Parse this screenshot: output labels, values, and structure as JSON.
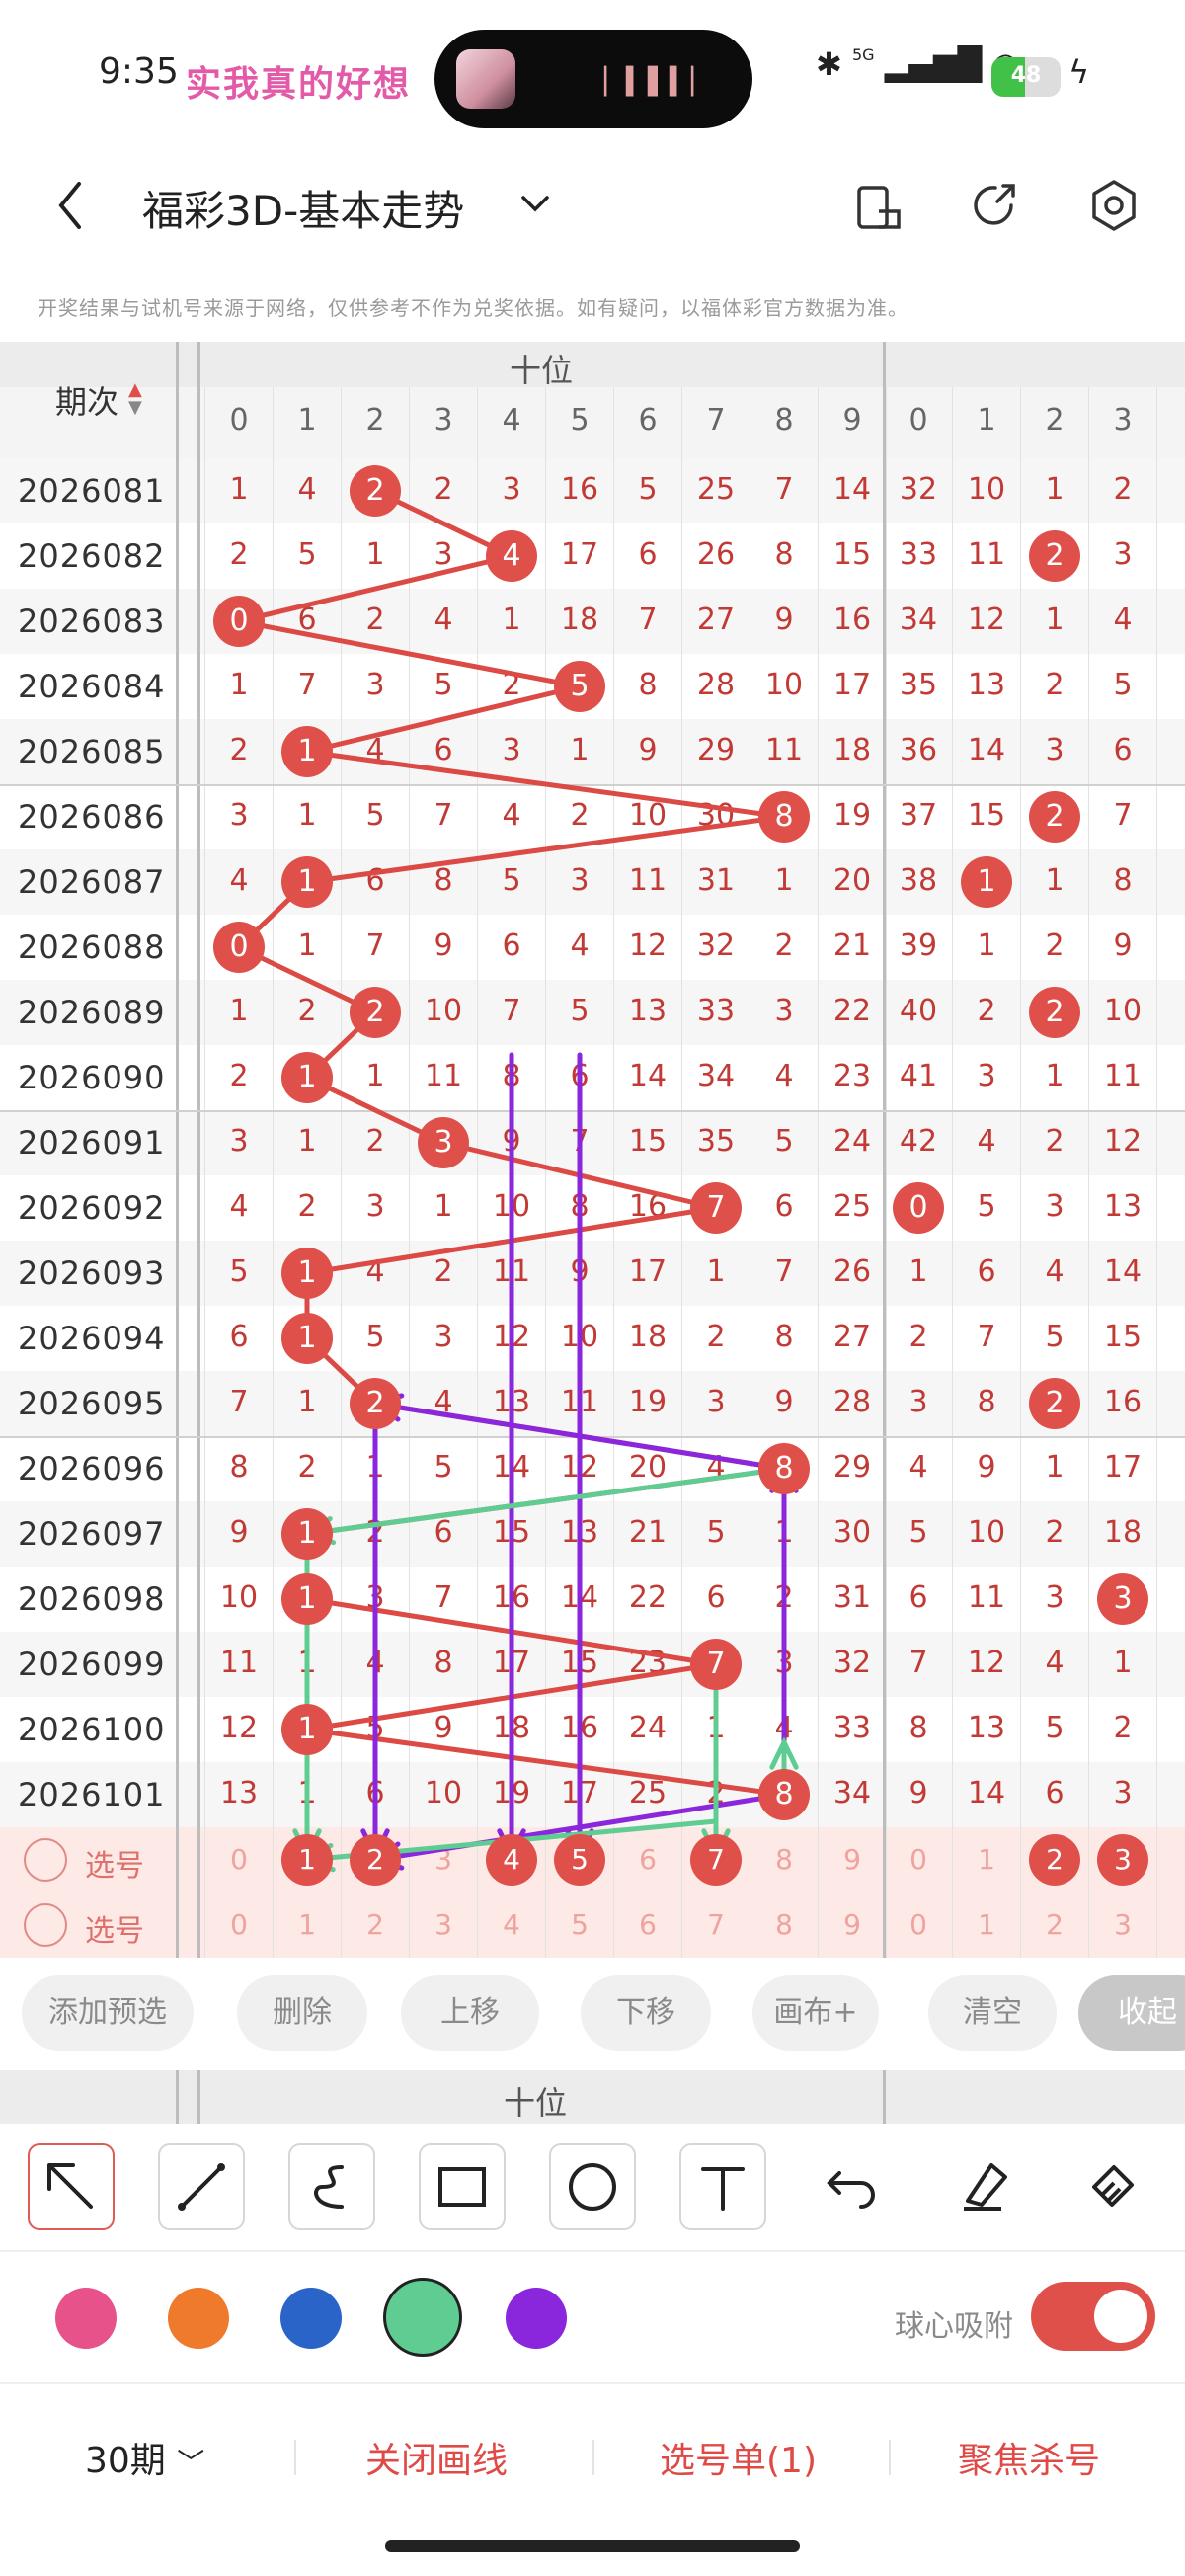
{
  "status": {
    "time": "9:35",
    "marquee": "实我真的好想",
    "battery": "48",
    "signal_label": "5G"
  },
  "header": {
    "title": "福彩3D-基本走势"
  },
  "disclaimer": "开奖结果与试机号来源于网络，仅供参考不作为兑奖依据。如有疑问，以福体彩官方数据为准。",
  "grid": {
    "period_label": "期次",
    "section_label": "十位",
    "columns": [
      "0",
      "1",
      "2",
      "3",
      "4",
      "5",
      "6",
      "7",
      "8",
      "9"
    ],
    "columns_next": [
      "0",
      "1",
      "2",
      "3"
    ],
    "select_label": "选号",
    "rows": [
      {
        "period": "2026081",
        "cells": [
          "1",
          "4",
          "2",
          "2",
          "3",
          "16",
          "5",
          "25",
          "7",
          "14"
        ],
        "next": [
          "32",
          "10",
          "1",
          "2"
        ],
        "hit": 2
      },
      {
        "period": "2026082",
        "cells": [
          "2",
          "5",
          "1",
          "3",
          "4",
          "17",
          "6",
          "26",
          "8",
          "15"
        ],
        "next": [
          "33",
          "11",
          "2",
          "3"
        ],
        "hit": 4
      },
      {
        "period": "2026083",
        "cells": [
          "0",
          "6",
          "2",
          "4",
          "1",
          "18",
          "7",
          "27",
          "9",
          "16"
        ],
        "next": [
          "34",
          "12",
          "1",
          "4"
        ],
        "hit": 0
      },
      {
        "period": "2026084",
        "cells": [
          "1",
          "7",
          "3",
          "5",
          "2",
          "5",
          "8",
          "28",
          "10",
          "17"
        ],
        "next": [
          "35",
          "13",
          "2",
          "5"
        ],
        "hit": 5
      },
      {
        "period": "2026085",
        "cells": [
          "2",
          "1",
          "4",
          "6",
          "3",
          "1",
          "9",
          "29",
          "11",
          "18"
        ],
        "next": [
          "36",
          "14",
          "3",
          "6"
        ],
        "hit": 1
      },
      {
        "period": "2026086",
        "cells": [
          "3",
          "1",
          "5",
          "7",
          "4",
          "2",
          "10",
          "30",
          "8",
          "19"
        ],
        "next": [
          "37",
          "15",
          "2",
          "7"
        ],
        "hit": 8
      },
      {
        "period": "2026087",
        "cells": [
          "4",
          "1",
          "6",
          "8",
          "5",
          "3",
          "11",
          "31",
          "1",
          "20"
        ],
        "next": [
          "38",
          "1",
          "1",
          "8"
        ],
        "hit": 1
      },
      {
        "period": "2026088",
        "cells": [
          "0",
          "1",
          "7",
          "9",
          "6",
          "4",
          "12",
          "32",
          "2",
          "21"
        ],
        "next": [
          "39",
          "1",
          "2",
          "9"
        ],
        "hit": 0
      },
      {
        "period": "2026089",
        "cells": [
          "1",
          "2",
          "2",
          "10",
          "7",
          "5",
          "13",
          "33",
          "3",
          "22"
        ],
        "next": [
          "40",
          "2",
          "2",
          "10"
        ],
        "hit": 2
      },
      {
        "period": "2026090",
        "cells": [
          "2",
          "1",
          "1",
          "11",
          "8",
          "6",
          "14",
          "34",
          "4",
          "23"
        ],
        "next": [
          "41",
          "3",
          "1",
          "11"
        ],
        "hit": 1
      },
      {
        "period": "2026091",
        "cells": [
          "3",
          "1",
          "2",
          "3",
          "9",
          "7",
          "15",
          "35",
          "5",
          "24"
        ],
        "next": [
          "42",
          "4",
          "2",
          "12"
        ],
        "hit": 3
      },
      {
        "period": "2026092",
        "cells": [
          "4",
          "2",
          "3",
          "1",
          "10",
          "8",
          "16",
          "7",
          "6",
          "25"
        ],
        "next": [
          "0",
          "5",
          "3",
          "13"
        ],
        "hit": 7
      },
      {
        "period": "2026093",
        "cells": [
          "5",
          "1",
          "4",
          "2",
          "11",
          "9",
          "17",
          "1",
          "7",
          "26"
        ],
        "next": [
          "1",
          "6",
          "4",
          "14"
        ],
        "hit": 1
      },
      {
        "period": "2026094",
        "cells": [
          "6",
          "1",
          "5",
          "3",
          "12",
          "10",
          "18",
          "2",
          "8",
          "27"
        ],
        "next": [
          "2",
          "7",
          "5",
          "15"
        ],
        "hit": 1
      },
      {
        "period": "2026095",
        "cells": [
          "7",
          "1",
          "2",
          "4",
          "13",
          "11",
          "19",
          "3",
          "9",
          "28"
        ],
        "next": [
          "3",
          "8",
          "2",
          "16"
        ],
        "hit": 2
      },
      {
        "period": "2026096",
        "cells": [
          "8",
          "2",
          "1",
          "5",
          "14",
          "12",
          "20",
          "4",
          "8",
          "29"
        ],
        "next": [
          "4",
          "9",
          "1",
          "17"
        ],
        "hit": 8
      },
      {
        "period": "2026097",
        "cells": [
          "9",
          "1",
          "2",
          "6",
          "15",
          "13",
          "21",
          "5",
          "1",
          "30"
        ],
        "next": [
          "5",
          "10",
          "2",
          "18"
        ],
        "hit": 1
      },
      {
        "period": "2026098",
        "cells": [
          "10",
          "1",
          "3",
          "7",
          "16",
          "14",
          "22",
          "6",
          "2",
          "31"
        ],
        "next": [
          "6",
          "11",
          "3",
          "3"
        ],
        "hit": 1
      },
      {
        "period": "2026099",
        "cells": [
          "11",
          "1",
          "4",
          "8",
          "17",
          "15",
          "23",
          "7",
          "3",
          "32"
        ],
        "next": [
          "7",
          "12",
          "4",
          "1"
        ],
        "hit": 7
      },
      {
        "period": "2026100",
        "cells": [
          "12",
          "1",
          "5",
          "9",
          "18",
          "16",
          "24",
          "1",
          "4",
          "33"
        ],
        "next": [
          "8",
          "13",
          "5",
          "2"
        ],
        "hit": 1
      },
      {
        "period": "2026101",
        "cells": [
          "13",
          "1",
          "6",
          "10",
          "19",
          "17",
          "25",
          "2",
          "8",
          "34"
        ],
        "next": [
          "9",
          "14",
          "6",
          "3"
        ],
        "hit": 8
      }
    ],
    "next_hits": {
      "2026082": 2,
      "2026086": 2,
      "2026087": 1,
      "2026089": 2,
      "2026092": 0,
      "2026095": 2,
      "2026098": 3
    }
  },
  "actions": [
    "添加预选",
    "删除",
    "上移",
    "下移",
    "画布+",
    "清空",
    "收起"
  ],
  "section_label_bottom": "十位",
  "tools": [
    "arrow-tool",
    "line-tool",
    "curve-tool",
    "rect-tool",
    "circle-tool",
    "text-tool",
    "undo-tool",
    "eraser-tool",
    "clear-tool"
  ],
  "colors": [
    "#e8528a",
    "#ef7a2c",
    "#2a64c8",
    "#5fcd92",
    "#8a26dc"
  ],
  "snap_label": "球心吸附",
  "bottom": {
    "periods": "30期",
    "close_line": "关闭画线",
    "selection": "选号单(1)",
    "focus": "聚焦杀号"
  }
}
